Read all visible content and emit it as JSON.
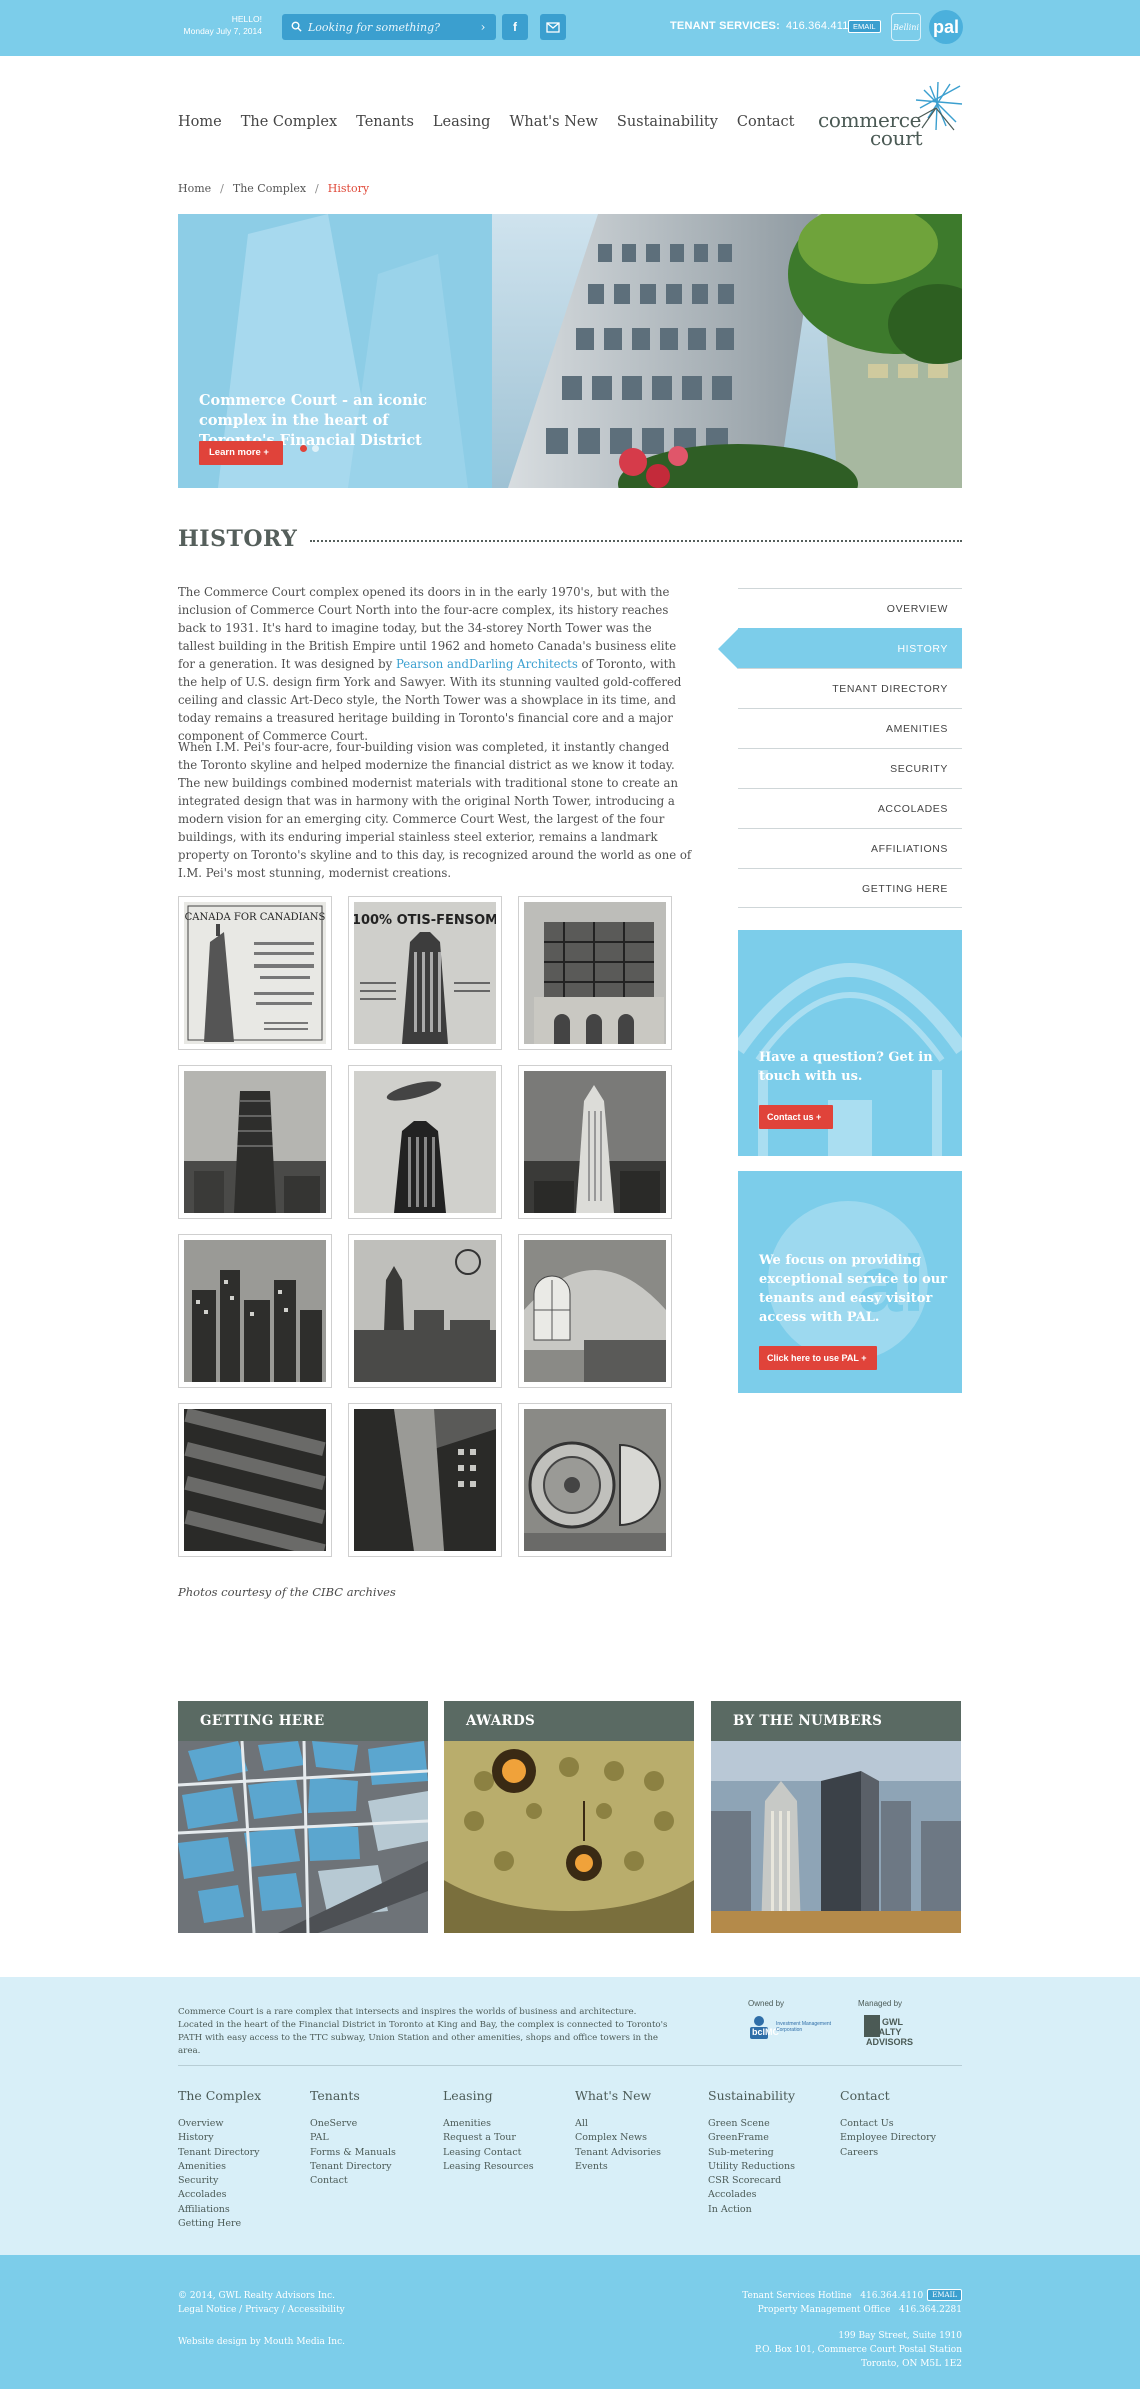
{
  "topbar": {
    "greeting": "HELLO!",
    "date": "Monday July 7, 2014",
    "search_placeholder": "Looking for something?",
    "facebook": "f",
    "tenant_services_label": "TENANT SERVICES:",
    "tenant_services_phone": "416.364.4110",
    "email_badge": "EMAIL",
    "bellini": "Bellini",
    "pal": "pal"
  },
  "nav": {
    "items": [
      "Home",
      "The Complex",
      "Tenants",
      "Leasing",
      "What's New",
      "Sustainability",
      "Contact"
    ]
  },
  "logo": {
    "line1": "commerce",
    "line2": "court"
  },
  "breadcrumb": {
    "items": [
      "Home",
      "The Complex"
    ],
    "current": "History"
  },
  "hero": {
    "caption": "Commerce Court - an iconic complex in the heart of Toronto's Financial District",
    "button": "Learn more  +"
  },
  "page": {
    "title": "HISTORY"
  },
  "content": {
    "p1_before": "The Commerce Court complex opened its doors in in the early 1970's, but with the inclusion of Commerce Court North into the four-acre complex, its history reaches back to 1931. It's hard to imagine today, but the 34-storey North Tower was the tallest building in the British Empire until 1962 and hometo Canada's business elite for a generation. It was designed by ",
    "p1_link": "Pearson andDarling Architects",
    "p1_after": " of Toronto, with the help of U.S. design firm York and Sawyer. With its stunning vaulted gold-coffered ceiling and classic Art-Deco style, the North Tower was a showplace in its time, and today remains a treasured heritage building in Toronto's financial core and a major component of Commerce Court.",
    "p2": "When I.M. Pei's four-acre, four-building vision was completed, it instantly changed the Toronto skyline and helped modernize the  financial district as we know it today. The new buildings combined modernist materials with traditional stone to create an integrated design that was in harmony with the original North Tower, introducing a modern vision for an emerging city. Commerce Court West, the largest of the four buildings, with its enduring imperial stainless steel exterior, remains a landmark property on Toronto's skyline and to this day, is recognized around the world as one of I.M. Pei's most stunning, modernist creations.",
    "photo_credit": "Photos courtesy of the CIBC archives",
    "thumb1_text": "CANADA FOR CANADIANS",
    "thumb2_text": "100% OTIS-FENSOM"
  },
  "sidenav": {
    "items": [
      "OVERVIEW",
      "HISTORY",
      "TENANT DIRECTORY",
      "AMENITIES",
      "SECURITY",
      "ACCOLADES",
      "AFFILIATIONS",
      "GETTING HERE"
    ],
    "active": "HISTORY"
  },
  "promo1": {
    "text": "Have a question? Get in touch with us.",
    "button": "Contact us  +"
  },
  "promo2": {
    "text": "We focus on providing exceptional service to our tenants and easy visitor access with PAL.",
    "button": "Click here to use PAL  +"
  },
  "cards": [
    {
      "title": "GETTING HERE"
    },
    {
      "title": "AWARDS"
    },
    {
      "title": "BY THE NUMBERS"
    }
  ],
  "footer": {
    "about": "Commerce Court is a rare complex that intersects and inspires the worlds of business and architecture. Located in the heart of the Financial District in Toronto at King and Bay, the complex is connected to Toronto's PATH with easy access to the TTC subway, Union Station and other amenities, shops and office towers in the area.",
    "owned_by": "Owned by",
    "managed_by": "Managed by",
    "bcimc_logo": "bcIMC",
    "bcimc_sub": "Investment Management Corporation",
    "gwl_logo": "GWL REALTY ADVISORS",
    "columns": [
      {
        "title": "The Complex",
        "links": [
          "Overview",
          "History",
          "Tenant Directory",
          "Amenities",
          "Security",
          "Accolades",
          "Affiliations",
          "Getting Here"
        ]
      },
      {
        "title": "Tenants",
        "links": [
          "OneServe",
          "PAL",
          "Forms & Manuals",
          "Tenant Directory",
          "Contact"
        ]
      },
      {
        "title": "Leasing",
        "links": [
          "Amenities",
          "Request a Tour",
          "Leasing Contact",
          "Leasing Resources"
        ]
      },
      {
        "title": "What's New",
        "links": [
          "All",
          "Complex News",
          "Tenant Advisories",
          "Events"
        ]
      },
      {
        "title": "Sustainability",
        "links": [
          "Green Scene",
          "GreenFrame",
          "Sub-metering",
          "Utility Reductions",
          "CSR Scorecard",
          "Accolades",
          "In Action"
        ]
      },
      {
        "title": "Contact",
        "links": [
          "Contact Us",
          "Employee Directory",
          "Careers"
        ]
      }
    ]
  },
  "bottom": {
    "copyright": "© 2014, GWL Realty Advisors Inc.",
    "legal": "Legal Notice / Privacy / Accessibility",
    "credit": "Website design by Mouth Media Inc.",
    "hotline_label": "Tenant Services Hotline",
    "hotline_phone": "416.364.4110",
    "email_badge": "EMAIL",
    "pmo_label": "Property Management Office",
    "pmo_phone": "416.364.2281",
    "addr1": "199 Bay Street, Suite 1910",
    "addr2": "P.O. Box 101, Commerce Court Postal Station",
    "addr3": "Toronto, ON  M5L 1E2"
  },
  "colors": {
    "accent": "#7ccdea",
    "accent_dark": "#3b9fcf",
    "red": "#e0433a",
    "slate": "#5a6a63"
  }
}
